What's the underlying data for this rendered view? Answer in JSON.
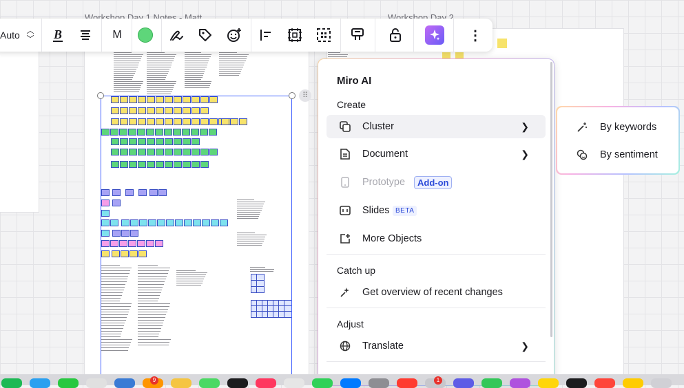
{
  "canvas": {
    "frame_left_title": "Workshop Day 1 Notes - Matt",
    "frame_right_title": "Workshop Day 2"
  },
  "toolbar": {
    "font_size_value": "Auto",
    "font_letter": "M",
    "color_swatch": "#5ed67a",
    "items": [
      "bold-icon",
      "align-center-icon",
      "font-select",
      "color-swatch",
      "pen-icon",
      "tag-icon",
      "reaction-icon",
      "align-left-icon",
      "frame-icon",
      "grid-select-icon",
      "card-icon",
      "unlock-icon",
      "miro-ai-icon",
      "more-icon"
    ]
  },
  "menu": {
    "title": "Miro AI",
    "sections": {
      "create": "Create",
      "catch_up": "Catch up",
      "adjust": "Adjust"
    },
    "items": {
      "cluster": "Cluster",
      "document": "Document",
      "prototype": "Prototype",
      "prototype_badge": "Add-on",
      "slides": "Slides",
      "slides_badge": "BETA",
      "more_objects": "More Objects",
      "overview": "Get overview of recent changes",
      "translate": "Translate"
    }
  },
  "submenu": {
    "by_keywords": "By keywords",
    "by_sentiment": "By sentiment"
  },
  "dock": {
    "badges": [
      "9",
      "1"
    ]
  },
  "colors": {
    "accent": "#2c4bd8",
    "sticky_yellow": "#f7e36b",
    "sticky_green": "#5ed67a",
    "sticky_purple": "#a7a3f5",
    "sticky_pink": "#f59ee8",
    "sticky_cyan": "#7ee2ee",
    "ai_button": "#8b5cf6"
  }
}
